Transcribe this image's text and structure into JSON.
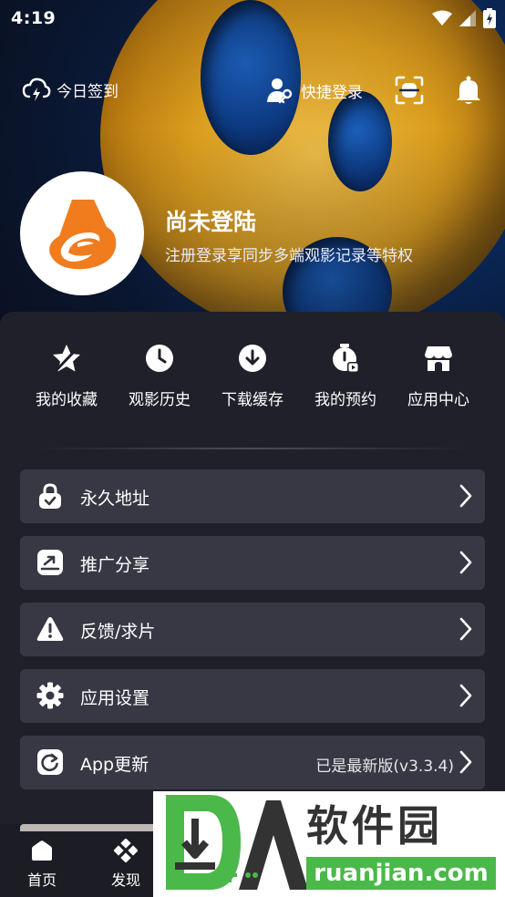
{
  "status_bar": {
    "time": "4:19"
  },
  "header": {
    "checkin_label": "今日签到",
    "quick_login_label": "快捷登录"
  },
  "profile": {
    "name": "尚未登陆",
    "subtitle": "注册登录享同步多端观影记录等特权"
  },
  "quick_actions": [
    {
      "label": "我的收藏",
      "icon": "star-icon"
    },
    {
      "label": "观影历史",
      "icon": "clock-icon"
    },
    {
      "label": "下载缓存",
      "icon": "download-icon"
    },
    {
      "label": "我的预约",
      "icon": "reservation-icon"
    },
    {
      "label": "应用中心",
      "icon": "store-icon"
    }
  ],
  "menu": [
    {
      "label": "永久地址",
      "icon": "lock-icon"
    },
    {
      "label": "推广分享",
      "icon": "share-icon"
    },
    {
      "label": "反馈/求片",
      "icon": "warning-icon"
    },
    {
      "label": "应用设置",
      "icon": "gear-icon"
    },
    {
      "label": "App更新",
      "icon": "refresh-icon",
      "extra": "已是最新版(v3.3.4)"
    }
  ],
  "bottom_nav": [
    {
      "label": "首页",
      "icon": "home-icon"
    },
    {
      "label": "发现",
      "icon": "discover-icon"
    }
  ],
  "watermark": {
    "brand": "软件园",
    "url": "ruanjian.com"
  },
  "colors": {
    "panel_bg": "#1f2029",
    "card_bg": "#373843",
    "logo_orange": "#f07c1e",
    "watermark_green": "#4bb84a"
  }
}
